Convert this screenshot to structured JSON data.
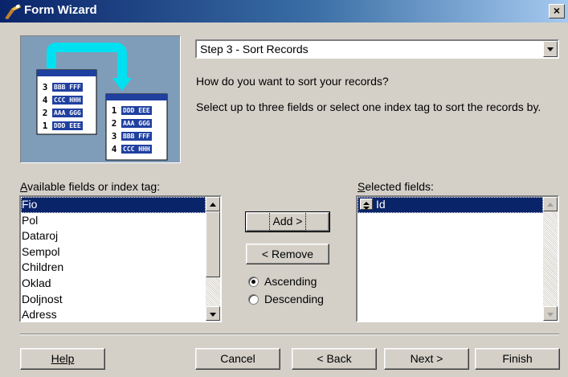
{
  "window": {
    "title": "Form Wizard",
    "close_glyph": "×"
  },
  "step_select": {
    "value": "Step 3 - Sort Records"
  },
  "instructions": {
    "question": "How do you want to sort your records?",
    "detail": "Select up to three fields or select one index tag to sort the records by."
  },
  "illustration": {
    "source_rows": [
      {
        "n": "3",
        "t": "BBB FFF"
      },
      {
        "n": "4",
        "t": "CCC HHH"
      },
      {
        "n": "2",
        "t": "AAA GGG"
      },
      {
        "n": "1",
        "t": "DDD EEE"
      }
    ],
    "sorted_rows": [
      {
        "n": "1",
        "t": "DDD EEE"
      },
      {
        "n": "2",
        "t": "AAA GGG"
      },
      {
        "n": "3",
        "t": "BBB FFF"
      },
      {
        "n": "4",
        "t": "CCC HHH"
      }
    ]
  },
  "available": {
    "label": "Available fields or index tag:",
    "items": [
      "Fio",
      "Pol",
      "Dataroj",
      "Sempol",
      "Children",
      "Oklad",
      "Doljnost",
      "Adress"
    ],
    "selected_index": 0
  },
  "selected": {
    "label": "Selected fields:",
    "items": [
      "Id"
    ]
  },
  "buttons": {
    "add": "Add >",
    "remove": "< Remove",
    "help": "Help",
    "cancel": "Cancel",
    "back": "< Back",
    "next": "Next >",
    "finish": "Finish"
  },
  "sort_order": {
    "ascending": "Ascending",
    "descending": "Descending",
    "value": "ascending"
  },
  "colors": {
    "title_start": "#0a246a",
    "title_end": "#a6caf0",
    "selection": "#0a246a",
    "dialog": "#d4d0c8"
  }
}
